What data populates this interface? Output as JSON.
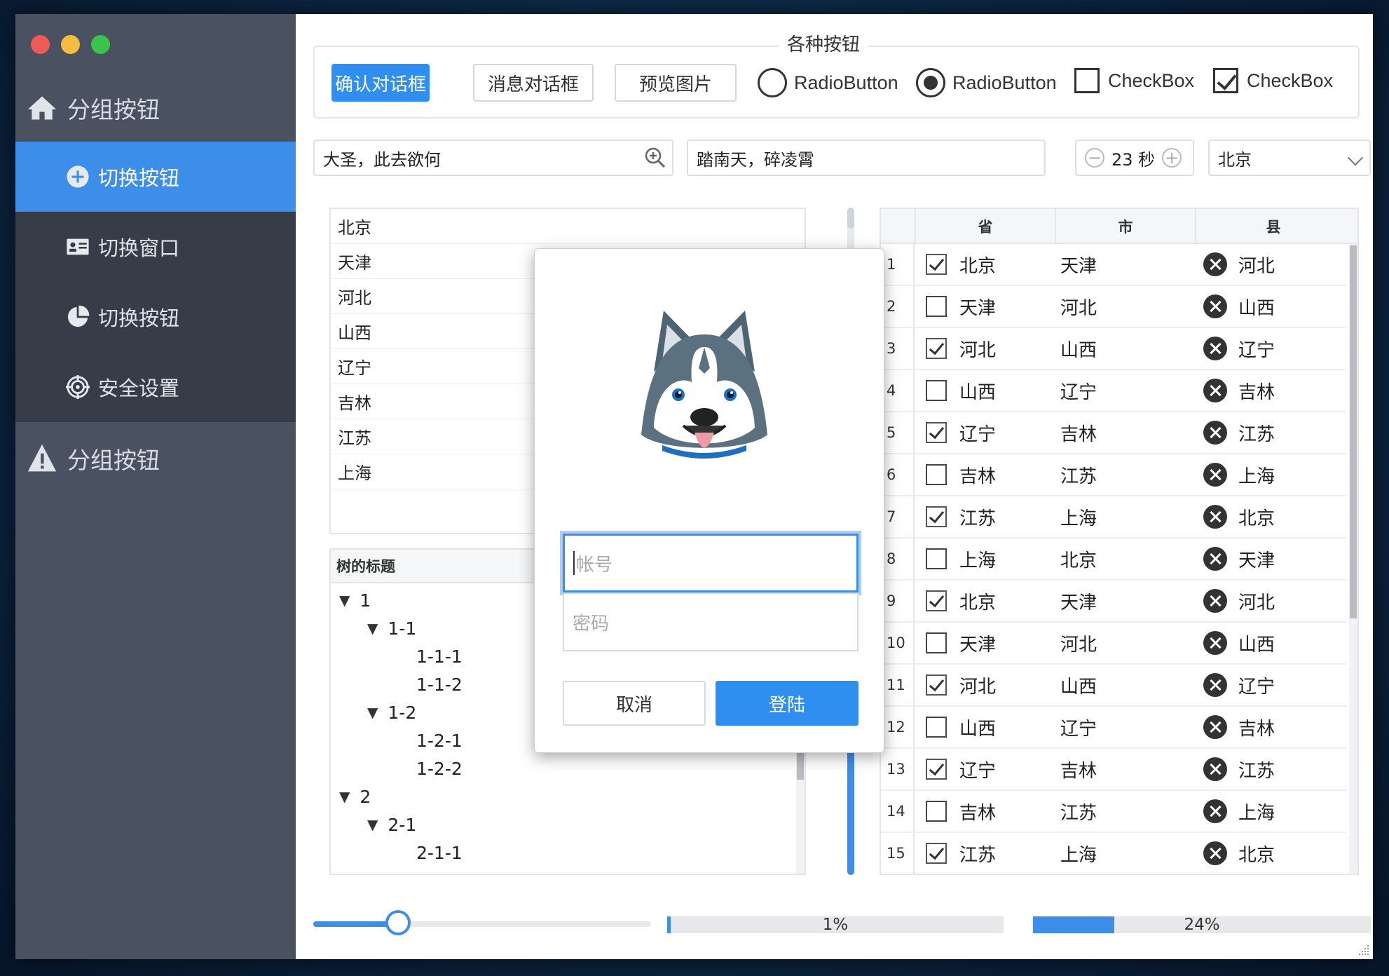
{
  "sidebar": {
    "group1_label": "分组按钮",
    "group2_label": "分组按钮",
    "items": [
      {
        "label": "切换按钮",
        "icon": "plus-circle-icon",
        "active": true
      },
      {
        "label": "切换窗口",
        "icon": "id-card-icon",
        "active": false
      },
      {
        "label": "切换按钮",
        "icon": "pie-chart-icon",
        "active": false
      },
      {
        "label": "安全设置",
        "icon": "crosshair-icon",
        "active": false
      }
    ]
  },
  "buttons_panel": {
    "legend": "各种按钮",
    "confirm_dialog": "确认对话框",
    "message_dialog": "消息对话框",
    "preview_image": "预览图片",
    "radio1": "RadioButton",
    "radio2": "RadioButton",
    "check1": "CheckBox",
    "check2": "CheckBox"
  },
  "inputs": {
    "search_value": "大圣，此去欲何",
    "text_value": "踏南天，碎凌霄",
    "spinner_value": "23 秒",
    "select_value": "北京"
  },
  "list": [
    "北京",
    "天津",
    "河北",
    "山西",
    "辽宁",
    "吉林",
    "江苏",
    "上海"
  ],
  "tree": {
    "title": "树的标题",
    "nodes": [
      {
        "label": "1",
        "level": 0,
        "expanded": true
      },
      {
        "label": "1-1",
        "level": 1,
        "expanded": true
      },
      {
        "label": "1-1-1",
        "level": 2
      },
      {
        "label": "1-1-2",
        "level": 2
      },
      {
        "label": "1-2",
        "level": 1,
        "expanded": true
      },
      {
        "label": "1-2-1",
        "level": 2
      },
      {
        "label": "1-2-2",
        "level": 2
      },
      {
        "label": "2",
        "level": 0,
        "expanded": true
      },
      {
        "label": "2-1",
        "level": 1,
        "expanded": true
      },
      {
        "label": "2-1-1",
        "level": 2
      }
    ]
  },
  "table": {
    "headers": [
      "省",
      "市",
      "县"
    ],
    "rows": [
      {
        "num": "1",
        "checked": true,
        "province": "北京",
        "city": "天津",
        "county": "河北"
      },
      {
        "num": "2",
        "checked": false,
        "province": "天津",
        "city": "河北",
        "county": "山西"
      },
      {
        "num": "3",
        "checked": true,
        "province": "河北",
        "city": "山西",
        "county": "辽宁"
      },
      {
        "num": "4",
        "checked": false,
        "province": "山西",
        "city": "辽宁",
        "county": "吉林"
      },
      {
        "num": "5",
        "checked": true,
        "province": "辽宁",
        "city": "吉林",
        "county": "江苏"
      },
      {
        "num": "6",
        "checked": false,
        "province": "吉林",
        "city": "江苏",
        "county": "上海"
      },
      {
        "num": "7",
        "checked": true,
        "province": "江苏",
        "city": "上海",
        "county": "北京"
      },
      {
        "num": "8",
        "checked": false,
        "province": "上海",
        "city": "北京",
        "county": "天津"
      },
      {
        "num": "9",
        "checked": true,
        "province": "北京",
        "city": "天津",
        "county": "河北"
      },
      {
        "num": "10",
        "checked": false,
        "province": "天津",
        "city": "河北",
        "county": "山西"
      },
      {
        "num": "11",
        "checked": true,
        "province": "河北",
        "city": "山西",
        "county": "辽宁"
      },
      {
        "num": "12",
        "checked": false,
        "province": "山西",
        "city": "辽宁",
        "county": "吉林"
      },
      {
        "num": "13",
        "checked": true,
        "province": "辽宁",
        "city": "吉林",
        "county": "江苏"
      },
      {
        "num": "14",
        "checked": false,
        "province": "吉林",
        "city": "江苏",
        "county": "上海"
      },
      {
        "num": "15",
        "checked": true,
        "province": "江苏",
        "city": "上海",
        "county": "北京"
      }
    ]
  },
  "slider": {
    "value": 0.25
  },
  "progress1": {
    "text": "1%",
    "value": 0.01
  },
  "progress2": {
    "text": "24%",
    "value": 0.24
  },
  "login_dialog": {
    "account_placeholder": "帐号",
    "password_placeholder": "密码",
    "cancel": "取消",
    "login": "登陆"
  },
  "colors": {
    "accent": "#3d8ee8",
    "sidebar": "#4a5160",
    "submenu": "#363c48"
  }
}
